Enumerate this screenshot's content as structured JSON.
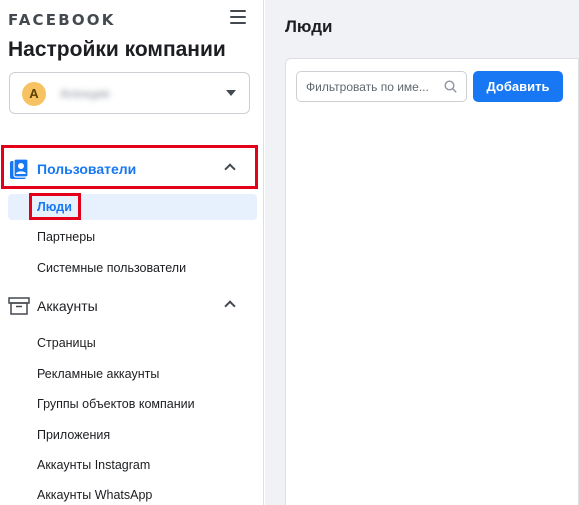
{
  "brand": "FACEBOOK",
  "sidebar": {
    "title": "Настройки компании",
    "account": {
      "initial": "A",
      "name": "Агенция"
    },
    "sections": [
      {
        "label": "Пользователи",
        "icon": "users-badge-icon",
        "items": [
          {
            "label": "Люди",
            "active": true
          },
          {
            "label": "Партнеры"
          },
          {
            "label": "Системные пользователи"
          }
        ]
      },
      {
        "label": "Аккаунты",
        "icon": "accounts-box-icon",
        "items": [
          {
            "label": "Страницы"
          },
          {
            "label": "Рекламные аккаунты"
          },
          {
            "label": "Группы объектов компании"
          },
          {
            "label": "Приложения"
          },
          {
            "label": "Аккаунты Instagram"
          },
          {
            "label": "Аккаунты WhatsApp"
          }
        ]
      }
    ]
  },
  "main": {
    "title": "Люди",
    "filter_placeholder": "Фильтровать по име...",
    "add_label": "Добавить"
  },
  "colors": {
    "accent": "#1877f2",
    "highlight": "#e2001a",
    "active_bg": "#e7f0fd"
  }
}
